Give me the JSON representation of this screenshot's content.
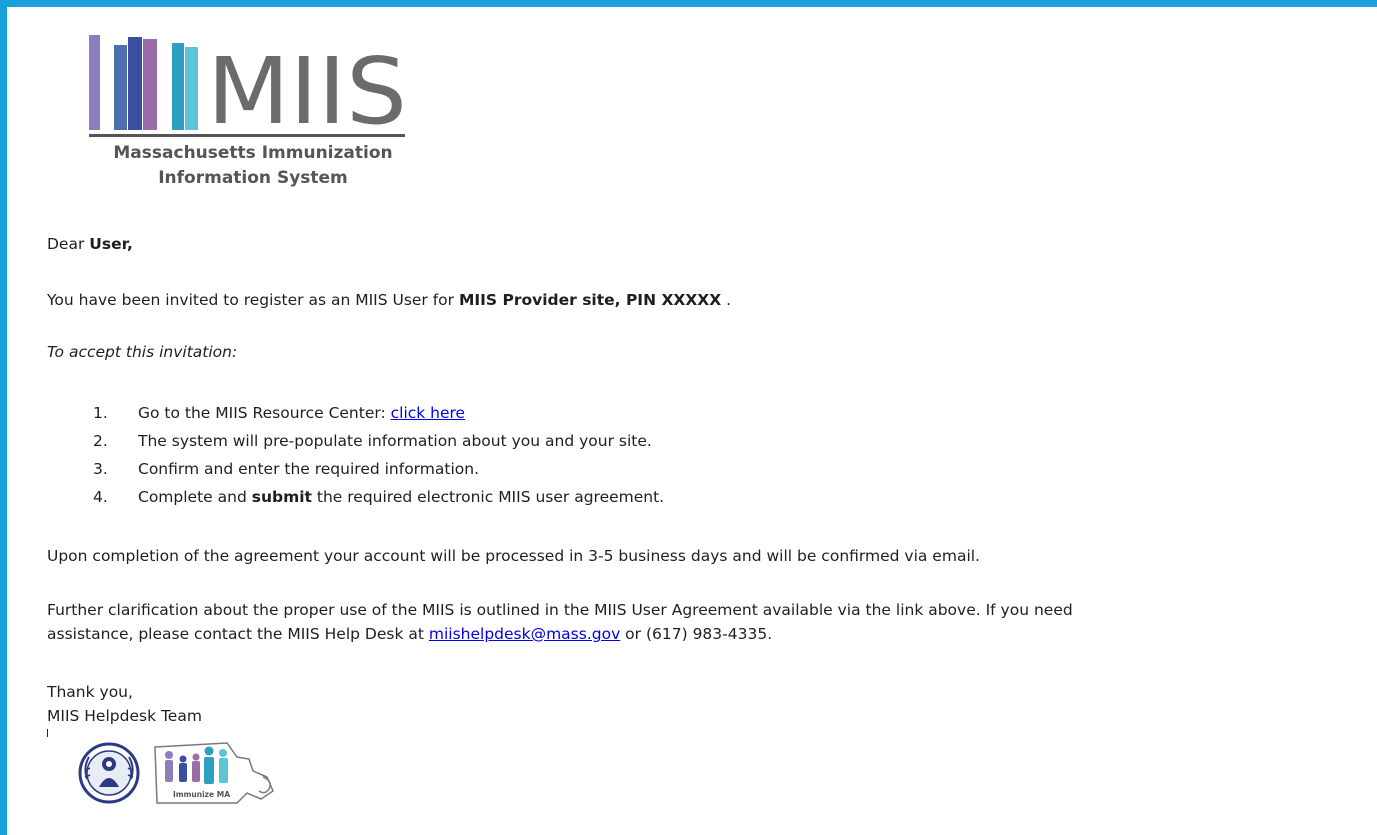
{
  "logo": {
    "title": "MIIS",
    "subtitle_line1": "Massachusetts Immunization",
    "subtitle_line2": "Information System",
    "bar_colors": [
      "#8e7dbd",
      "#4c6fb0",
      "#3a4fa0",
      "#9a6ca8",
      "#2e9fc0",
      "#5cc3d9"
    ]
  },
  "email": {
    "greeting_prefix": "Dear ",
    "greeting_name": "User,",
    "invite_prefix": "You have been invited to register as an MIIS User for ",
    "invite_site": "MIIS Provider site, PIN XXXXX",
    "invite_suffix": " .",
    "instructions_heading": "To accept this invitation:",
    "steps": [
      {
        "num": "1.",
        "text": "Go to the MIIS Resource Center: ",
        "link": "click here"
      },
      {
        "num": "2.",
        "text": "The system will pre-populate information about you and your site."
      },
      {
        "num": "3.",
        "text": "Confirm and enter the required information."
      },
      {
        "num": "4.",
        "prefix": "Complete and ",
        "bold": "submit",
        "suffix": " the required electronic MIIS user agreement."
      }
    ],
    "completion_text": "Upon completion of the agreement your account will be processed in 3-5 business days and will be confirmed via email.",
    "clarification_line1": "Further clarification about the proper use of the MIIS is outlined in the MIIS User Agreement available via the link above. If you need",
    "clarification_line2_prefix": "assistance, please contact the MIIS Help Desk at ",
    "helpdesk_email": "miishelpdesk@mass.gov",
    "clarification_line2_suffix": " or (617) 983-4335.",
    "closing": "Thank you,",
    "signature": "MIIS Helpdesk Team"
  },
  "signature_logos": {
    "immunize_label": "Immunize MA"
  },
  "colors": {
    "frame_border": "#1aa1dc",
    "link": "#0000ee"
  }
}
